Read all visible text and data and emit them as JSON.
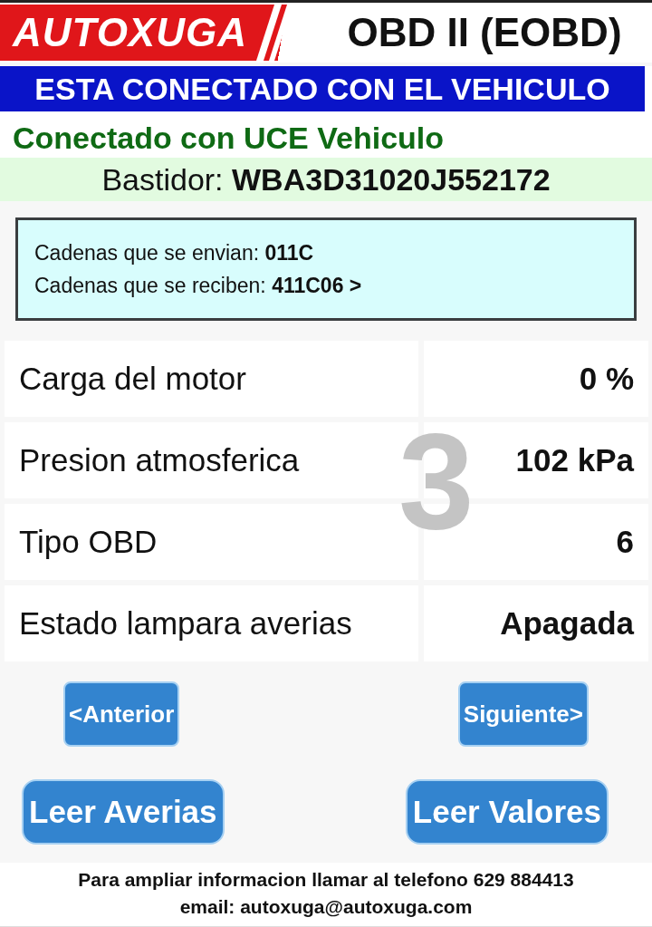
{
  "header": {
    "logo": "AUTOXUGA",
    "title": "OBD II (EOBD)"
  },
  "banner": "ESTA CONECTADO CON EL VEHICULO",
  "status": "Conectado con UCE Vehiculo",
  "vin": {
    "label": "Bastidor:",
    "value": "WBA3D31020J552172"
  },
  "strings": [
    {
      "label": "Cadenas que se envian:",
      "value": "011C"
    },
    {
      "label": "Cadenas que se reciben:",
      "value": "411C06 >"
    }
  ],
  "page_number": "3",
  "rows": [
    {
      "name": "Carga del motor",
      "value": "0 %"
    },
    {
      "name": "Presion atmosferica",
      "value": "102 kPa"
    },
    {
      "name": "Tipo OBD",
      "value": "6"
    },
    {
      "name": "Estado lampara averias",
      "value": "Apagada"
    }
  ],
  "nav_buttons": [
    "<Anterior",
    "Siguiente>"
  ],
  "action_buttons": [
    "Leer Averias",
    "Leer Valores"
  ],
  "footer": [
    "Para ampliar informacion llamar al telefono 629 884413",
    "email: autoxuga@autoxuga.com"
  ]
}
